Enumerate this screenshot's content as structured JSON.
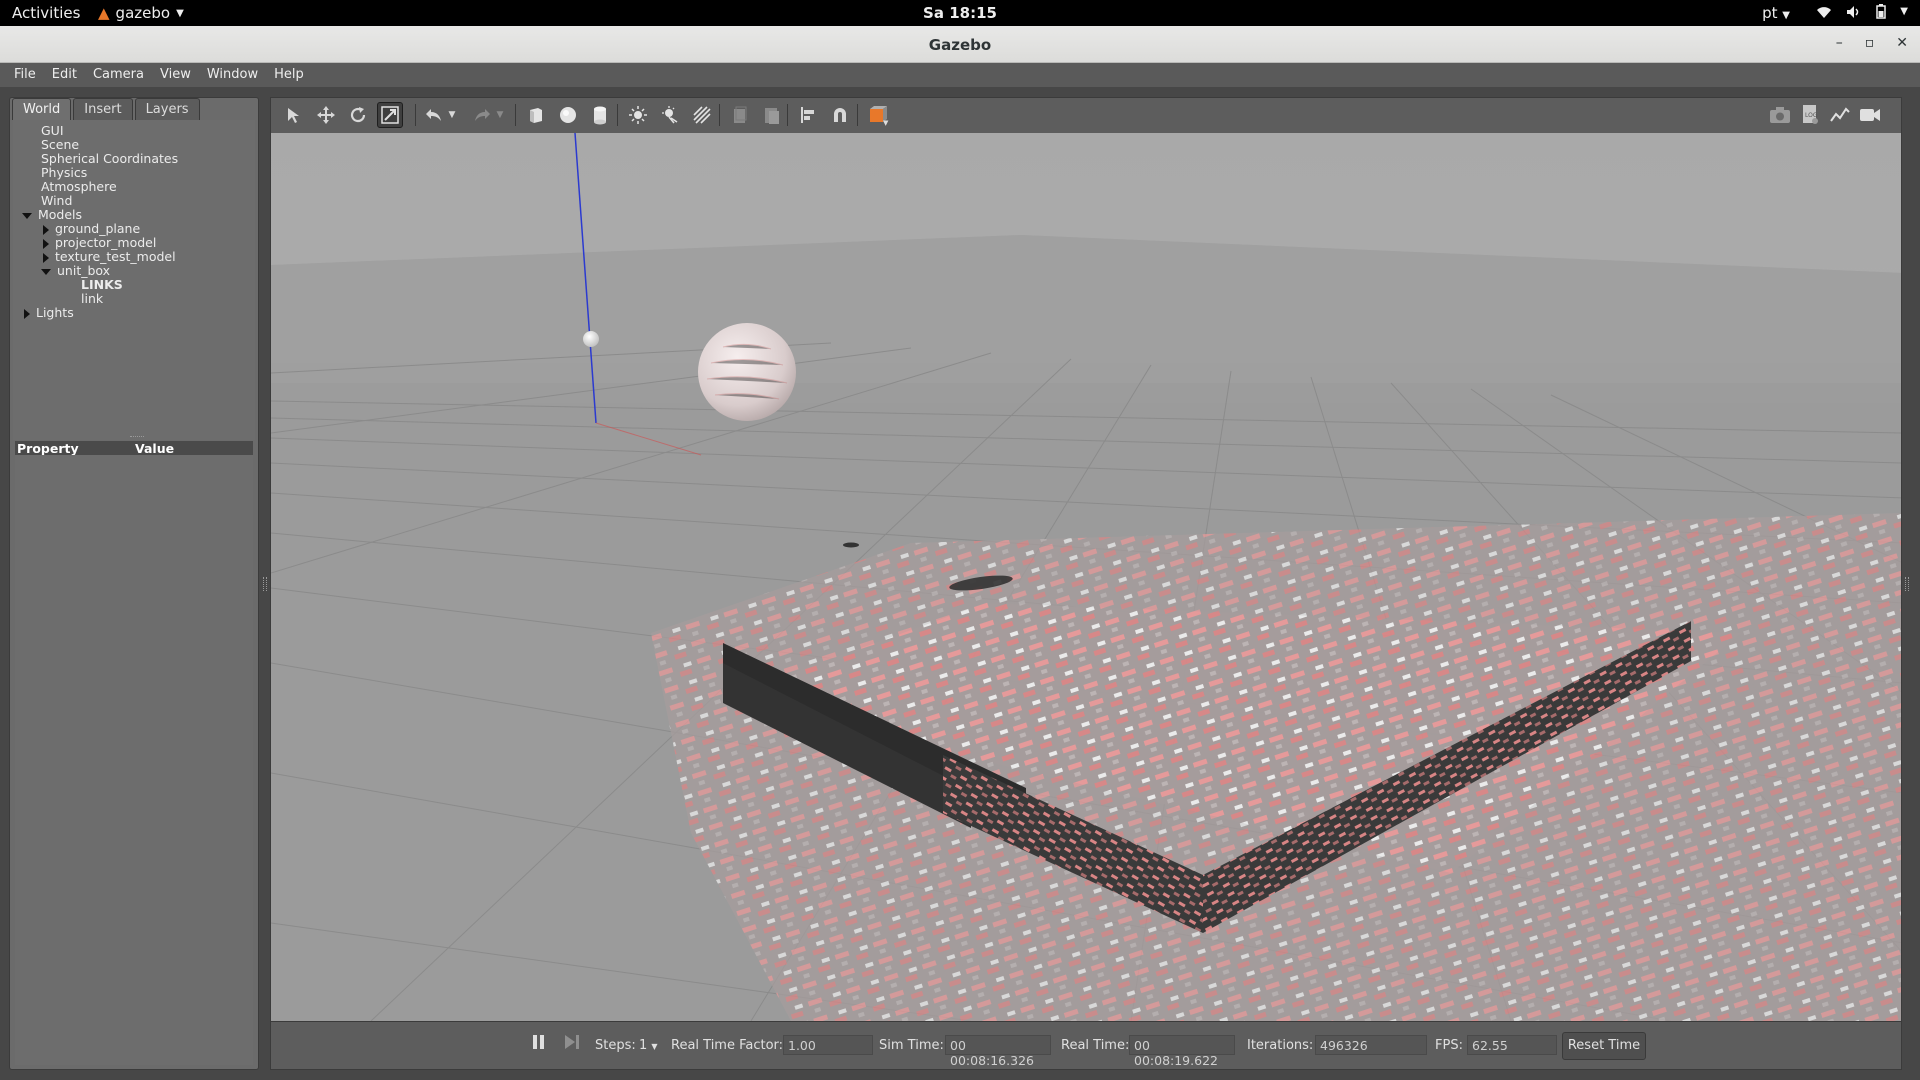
{
  "topbar": {
    "activities": "Activities",
    "app_name": "gazebo",
    "clock": "Sa 18:15",
    "language": "pt"
  },
  "window": {
    "title": "Gazebo"
  },
  "menubar": {
    "items": [
      "File",
      "Edit",
      "Camera",
      "View",
      "Window",
      "Help"
    ]
  },
  "left_panel": {
    "tabs": [
      "World",
      "Insert",
      "Layers"
    ],
    "active_tab": "World",
    "tree": {
      "gui": "GUI",
      "scene": "Scene",
      "spherical": "Spherical Coordinates",
      "physics": "Physics",
      "atmosphere": "Atmosphere",
      "wind": "Wind",
      "models": "Models",
      "model_items": [
        "ground_plane",
        "projector_model",
        "texture_test_model",
        "unit_box"
      ],
      "links_header": "LINKS",
      "link": "link",
      "lights": "Lights"
    },
    "property_header": {
      "property": "Property",
      "value": "Value"
    }
  },
  "toolbar": {
    "icons": [
      "select-arrow-icon",
      "translate-icon",
      "rotate-icon",
      "scale-icon",
      "undo-icon",
      "redo-icon",
      "box-icon",
      "sphere-icon",
      "cylinder-icon",
      "point-light-icon",
      "spot-light-icon",
      "directional-light-icon",
      "copy-icon",
      "paste-icon",
      "align-icon",
      "snap-icon",
      "view-angle-icon",
      "screenshot-icon",
      "log-icon",
      "plot-icon",
      "video-record-icon"
    ]
  },
  "bottom_bar": {
    "steps_label": "Steps:",
    "steps_value": "1",
    "rtf_label": "Real Time Factor:",
    "rtf_value": "1.00",
    "sim_time_label": "Sim Time:",
    "sim_time_value": "00 00:08:16.326",
    "real_time_label": "Real Time:",
    "real_time_value": "00 00:08:19.622",
    "iterations_label": "Iterations:",
    "iterations_value": "496326",
    "fps_label": "FPS:",
    "fps_value": "62.55",
    "reset_label": "Reset Time"
  },
  "colors": {
    "accent_orange": "#e8782a",
    "viewport_sky": "#ababab",
    "ground": "#9a9a9a",
    "texture_red": "#e88a8a"
  }
}
